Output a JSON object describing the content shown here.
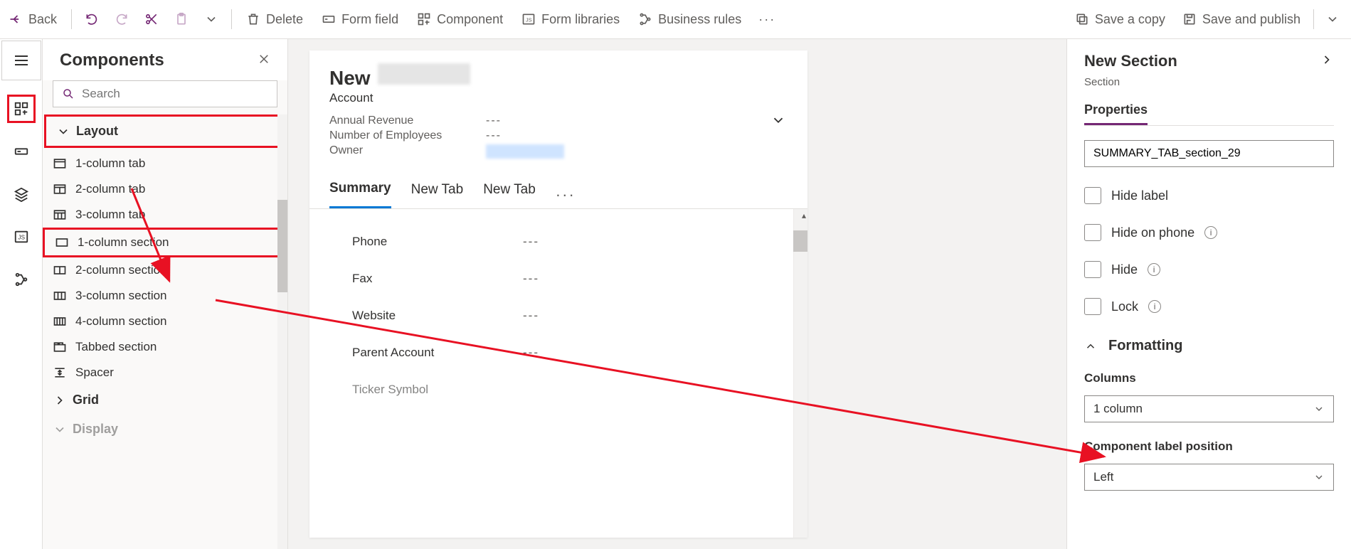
{
  "toolbar": {
    "back": "Back",
    "delete": "Delete",
    "form_field": "Form field",
    "component": "Component",
    "form_libraries": "Form libraries",
    "business_rules": "Business rules",
    "save_copy": "Save a copy",
    "save_publish": "Save and publish"
  },
  "components": {
    "title": "Components",
    "search_placeholder": "Search",
    "groups": {
      "layout": "Layout",
      "grid": "Grid",
      "display": "Display"
    },
    "items": {
      "tab1": "1-column tab",
      "tab2": "2-column tab",
      "tab3": "3-column tab",
      "sec1": "1-column section",
      "sec2": "2-column section",
      "sec3": "3-column section",
      "sec4": "4-column section",
      "tabbed": "Tabbed section",
      "spacer": "Spacer"
    }
  },
  "form": {
    "title": "New",
    "subtitle": "Account",
    "header_fields": {
      "annual_revenue": {
        "label": "Annual Revenue",
        "value": "---"
      },
      "employees": {
        "label": "Number of Employees",
        "value": "---"
      },
      "owner": {
        "label": "Owner"
      }
    },
    "tabs": {
      "summary": "Summary",
      "newtab1": "New Tab",
      "newtab2": "New Tab"
    },
    "fields": {
      "phone": {
        "label": "Phone",
        "value": "---"
      },
      "fax": {
        "label": "Fax",
        "value": "---"
      },
      "website": {
        "label": "Website",
        "value": "---"
      },
      "parent_account": {
        "label": "Parent Account",
        "value": "---"
      },
      "ticker": {
        "label": "Ticker Symbol",
        "value": ""
      }
    }
  },
  "rightpanel": {
    "title": "New Section",
    "subtitle": "Section",
    "tab": "Properties",
    "name_value": "SUMMARY_TAB_section_29",
    "checks": {
      "hide_label": "Hide label",
      "hide_phone": "Hide on phone",
      "hide": "Hide",
      "lock": "Lock"
    },
    "formatting_head": "Formatting",
    "columns_label": "Columns",
    "columns_value": "1 column",
    "label_pos_label": "Component label position",
    "label_pos_value": "Left"
  }
}
